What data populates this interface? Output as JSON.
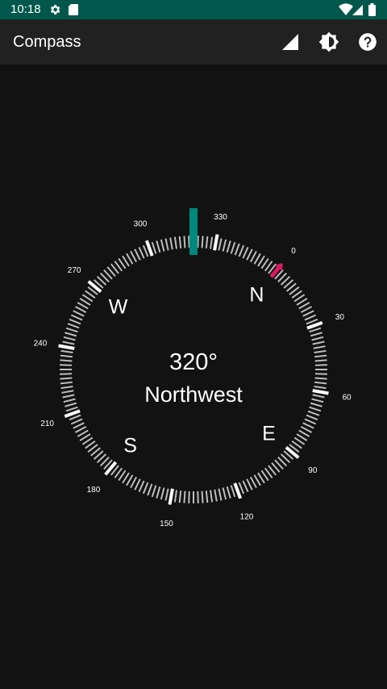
{
  "status_bar": {
    "time": "10:18",
    "icons": [
      "gear-icon",
      "sd-card-icon",
      "wifi-icon",
      "cell-signal-icon",
      "battery-icon"
    ]
  },
  "app_bar": {
    "title": "Compass",
    "actions": [
      {
        "name": "signal-triangle-icon"
      },
      {
        "name": "brightness-icon"
      },
      {
        "name": "help-icon"
      }
    ]
  },
  "compass": {
    "heading_text": "320°",
    "direction_text": "Northwest",
    "heading_degrees": 320,
    "cardinals": [
      {
        "label": "N",
        "bearing": 0
      },
      {
        "label": "E",
        "bearing": 90
      },
      {
        "label": "S",
        "bearing": 180
      },
      {
        "label": "W",
        "bearing": 270
      }
    ],
    "degree_labels": [
      "0",
      "30",
      "60",
      "90",
      "120",
      "150",
      "180",
      "210",
      "240",
      "270",
      "300",
      "330"
    ],
    "colors": {
      "heading_marker": "#00897b",
      "north_arrow": "#d81b60",
      "tick_minor": "#bdbdbd",
      "tick_major": "#ffffff"
    }
  }
}
